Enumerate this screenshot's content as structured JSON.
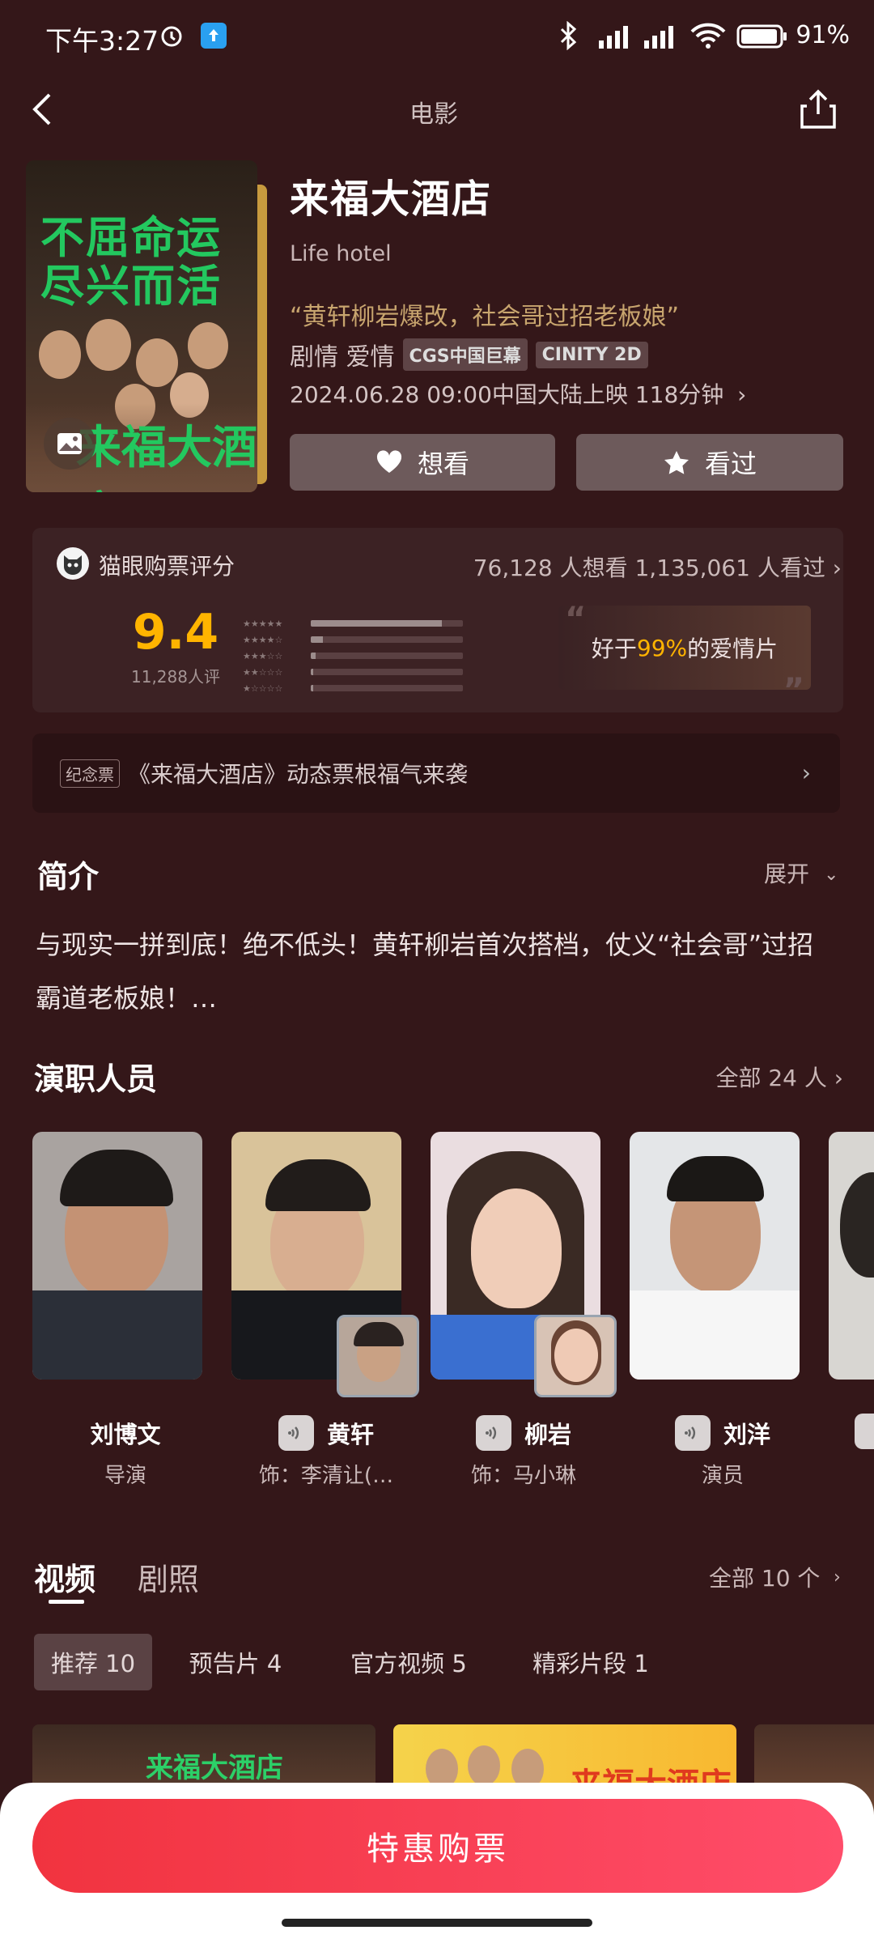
{
  "status_bar": {
    "time": "下午3:27",
    "battery": "91%"
  },
  "header": {
    "title": "电影"
  },
  "movie": {
    "title": "来福大酒店",
    "english_title": "Life hotel",
    "quote": "“黄轩柳岩爆改，社会哥过招老板娘”",
    "genres": "剧情 爱情",
    "tags": [
      "CGS中国巨幕",
      "CINITY 2D"
    ],
    "release": "2024.06.28 09:00中国大陆上映 118分钟",
    "poster_text_line1": "不屈命运",
    "poster_text_line2": "尽兴而活",
    "poster_logo": "来福大酒店"
  },
  "actions": {
    "want": "想看",
    "seen": "看过"
  },
  "rating": {
    "label": "猫眼购票评分",
    "counts": "76,128 人想看  1,135,061 人看过",
    "score": "9.4",
    "raters": "11,288人评",
    "distribution": [
      0.86,
      0.08,
      0.03,
      0.01,
      0.01
    ],
    "better_than_prefix": "好于",
    "better_than_value": "99%",
    "better_than_suffix": "的爱情片"
  },
  "promo": {
    "tag": "纪念票",
    "text": "《来福大酒店》动态票根福气来袭"
  },
  "intro": {
    "title": "简介",
    "expand": "展开",
    "text": "与现实一拼到底！绝不低头！黄轩柳岩首次搭档，仗义“社会哥”过招霸道老板娘！…"
  },
  "cast": {
    "title": "演职人员",
    "all": "全部 24 人",
    "members": [
      {
        "name": "刘博文",
        "role": "导演"
      },
      {
        "name": "黄轩",
        "role": "饰：李清让(…"
      },
      {
        "name": "柳岩",
        "role": "饰：马小琳"
      },
      {
        "name": "刘洋",
        "role": "演员"
      }
    ]
  },
  "videos": {
    "tabs": [
      "视频",
      "剧照"
    ],
    "all": "全部 10 个",
    "chips": [
      "推荐 10",
      "预告片 4",
      "官方视频 5",
      "精彩片段 1"
    ],
    "thumb_texts": [
      "来福大酒店",
      "来福大酒店"
    ]
  },
  "buy_button": "特惠购票",
  "colors": {
    "background": "#341719",
    "accent": "#ffb400",
    "buy": "#f1333f",
    "poster_green": "#23c85f"
  }
}
